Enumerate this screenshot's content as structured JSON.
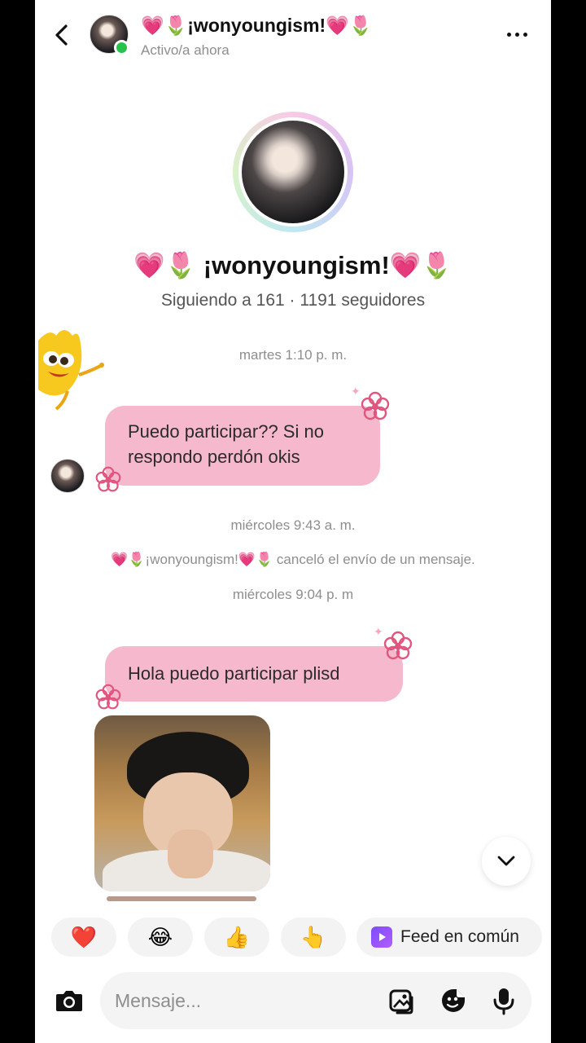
{
  "header": {
    "title": "💗🌷¡wonyoungism!💗🌷",
    "status": "Activo/a ahora"
  },
  "profile": {
    "name": "💗🌷 ¡wonyoungism!💗🌷",
    "stats": "Siguiendo a 161 · 1191 seguidores"
  },
  "thread": {
    "timestamp_1": "martes 1:10 p. m.",
    "message_1": "Puedo participar?? Si no respondo perdón okis",
    "timestamp_2": "miércoles 9:43 a. m.",
    "system_message": "💗🌷¡wonyoungism!💗🌷 canceló el envío de un mensaje.",
    "timestamp_3": "miércoles 9:04 p. m",
    "message_2": "Hola puedo participar plisd"
  },
  "reactions": [
    {
      "emoji": "❤️",
      "icon": "heart-icon"
    },
    {
      "emoji": "😂",
      "icon": "laughing-face-icon"
    },
    {
      "emoji": "👍",
      "icon": "thumbs-up-icon"
    },
    {
      "emoji": "👆",
      "icon": "pointing-hand-icon"
    }
  ],
  "feed_button": {
    "label": "Feed en común",
    "icon": "feed-video-icon"
  },
  "composer": {
    "placeholder": "Mensaje...",
    "icons": [
      "camera-icon",
      "gallery-icon",
      "sticker-icon",
      "microphone-icon"
    ]
  },
  "colors": {
    "bubble": "#f6b8cc",
    "flower": "#e0567f",
    "online": "#27c24c",
    "muted_text": "#8e8e8e"
  }
}
